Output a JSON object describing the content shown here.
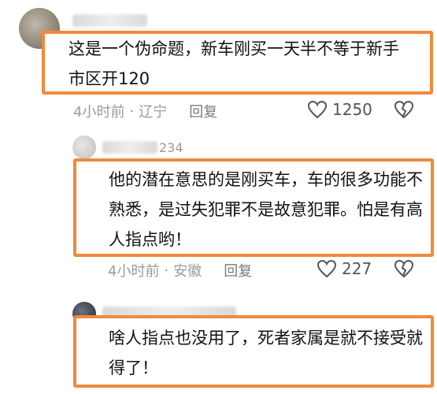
{
  "comments": [
    {
      "text": "这是一个伪命题，新车刚买一天半不等于新手市区开120",
      "time": "4小时前",
      "location": "辽宁",
      "reply_label": "回复",
      "likes": "1250"
    },
    {
      "name_suffix": "234",
      "text": "他的潜在意思的是刚买车，车的很多功能不熟悉，是过失犯罪不是故意犯罪。怕是有高人指点哟！",
      "time": "4小时前",
      "location": "安徽",
      "reply_label": "回复",
      "likes": "227"
    },
    {
      "text": "啥人指点也没用了，死者家属是就不接受就得了！"
    }
  ],
  "meta_separator": "·",
  "colors": {
    "highlight_border": "#f08a3c",
    "meta_text": "#9a9a9a"
  },
  "icons": {
    "like": "heart-outline-icon",
    "dislike": "broken-heart-icon"
  }
}
